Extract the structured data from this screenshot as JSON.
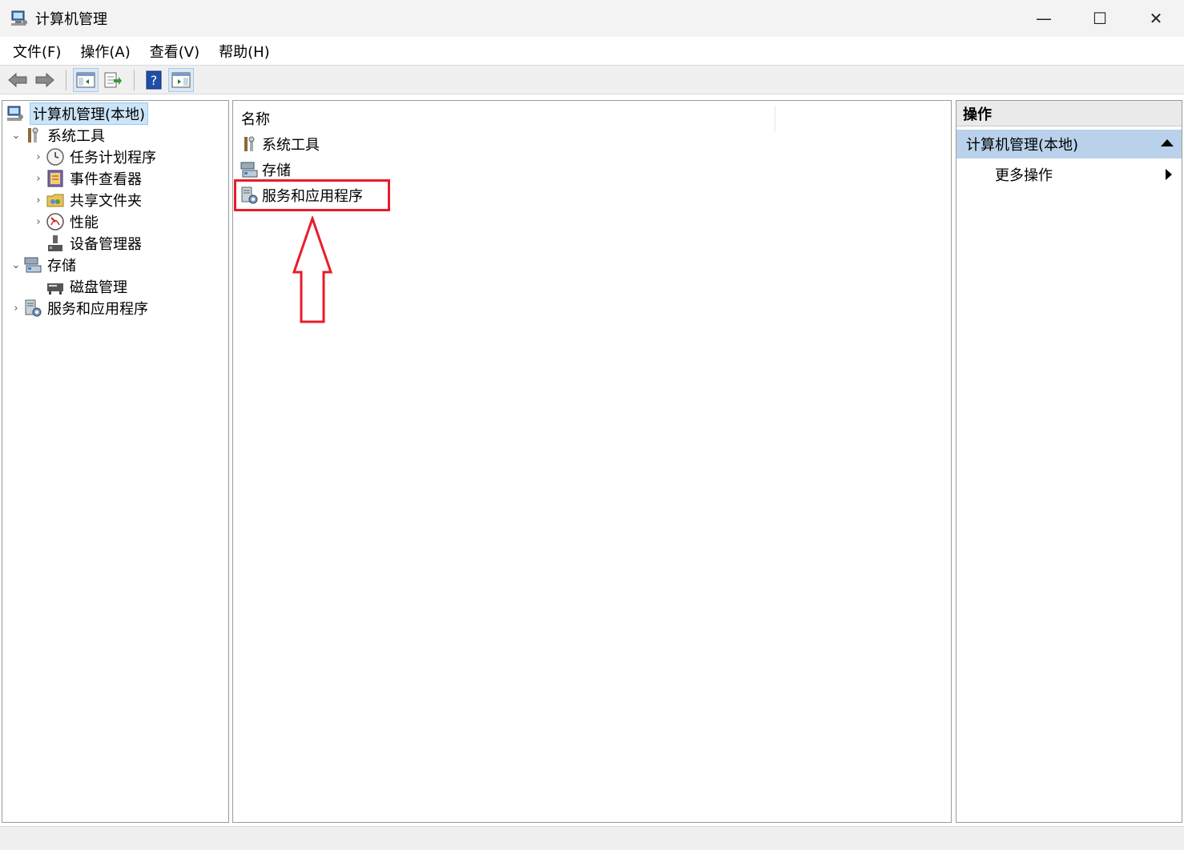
{
  "window": {
    "title": "计算机管理",
    "controls": {
      "minimize": "—",
      "maximize": "☐",
      "close": "✕"
    }
  },
  "menu": [
    "文件(F)",
    "操作(A)",
    "查看(V)",
    "帮助(H)"
  ],
  "toolbar": {
    "icons": [
      "back-arrow-icon",
      "forward-arrow-icon",
      "show-tree-icon",
      "export-list-icon",
      "help-icon",
      "show-action-pane-icon"
    ]
  },
  "tree": {
    "items": [
      {
        "label": "计算机管理(本地)",
        "icon": "computer-management-icon",
        "chevron": "",
        "selected": true
      },
      {
        "label": "系统工具",
        "icon": "system-tools-icon",
        "chevron": "⌄"
      },
      {
        "label": "任务计划程序",
        "icon": "clock-icon",
        "chevron": "›"
      },
      {
        "label": "事件查看器",
        "icon": "event-viewer-icon",
        "chevron": "›"
      },
      {
        "label": "共享文件夹",
        "icon": "shared-folder-icon",
        "chevron": "›"
      },
      {
        "label": "性能",
        "icon": "performance-icon",
        "chevron": "›"
      },
      {
        "label": "设备管理器",
        "icon": "device-manager-icon",
        "chevron": ""
      },
      {
        "label": "存储",
        "icon": "storage-icon",
        "chevron": "⌄"
      },
      {
        "label": "磁盘管理",
        "icon": "disk-management-icon",
        "chevron": ""
      },
      {
        "label": "服务和应用程序",
        "icon": "services-apps-icon",
        "chevron": "›"
      }
    ]
  },
  "list": {
    "column_header": "名称",
    "items": [
      {
        "label": "系统工具",
        "icon": "system-tools-icon"
      },
      {
        "label": "存储",
        "icon": "storage-icon"
      },
      {
        "label": "服务和应用程序",
        "icon": "services-apps-icon"
      }
    ]
  },
  "actions": {
    "header": "操作",
    "section": "计算机管理(本地)",
    "more": "更多操作"
  },
  "colors": {
    "highlight": "#e81c2a",
    "selection": "#cce4f7",
    "action_section": "#b9d1ea"
  }
}
